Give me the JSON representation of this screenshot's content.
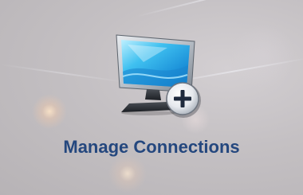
{
  "tile": {
    "label": "Manage Connections",
    "icon": "monitor-add-icon",
    "badge_icon": "plus-icon",
    "label_color": "#24477e",
    "background_color": "#c4c0c3"
  }
}
